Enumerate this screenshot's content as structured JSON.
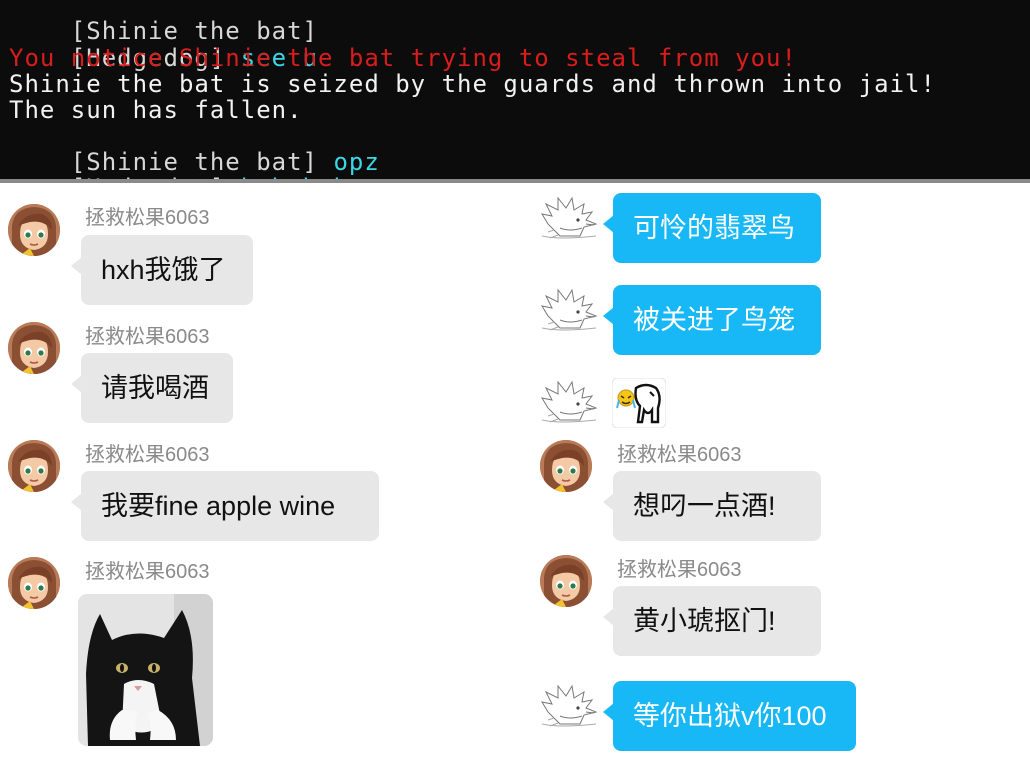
{
  "terminal": {
    "lines": [
      {
        "speaker": "[Shinie the bat]",
        "text": ""
      },
      {
        "speaker": "[Hedgedog]",
        "text": "see u"
      },
      {
        "alert": "You notice Shinie the bat trying to steal from you!"
      },
      {
        "plain": "Shinie the bat is seized by the guards and thrown into jail!"
      },
      {
        "plain": "The sun has fallen."
      },
      {
        "speaker": "[Shinie the bat]",
        "text": "opz"
      },
      {
        "speaker": "[Hedgedog]",
        "text": "hahahaha"
      }
    ]
  },
  "chat": {
    "sender_name": "拯救松果6063",
    "left": [
      {
        "text": "hxh我饿了"
      },
      {
        "text": "请我喝酒"
      },
      {
        "text": "我要fine apple wine"
      },
      {
        "image": "cat-photo"
      }
    ],
    "right": [
      {
        "from": "hedgehog",
        "text": "可怜的翡翠鸟"
      },
      {
        "from": "hedgehog",
        "text": "被关进了鸟笼"
      },
      {
        "from": "hedgehog",
        "sticker": "cat-sticker"
      },
      {
        "from": "girl",
        "text": "想叼一点酒!"
      },
      {
        "from": "girl",
        "text": "黄小琥抠门!"
      },
      {
        "from": "hedgehog",
        "text": "等你出狱v你100"
      }
    ]
  },
  "colors": {
    "terminal_bg": "#0c0c0c",
    "terminal_text": "#f2f2f2",
    "terminal_alert": "#d91c1c",
    "terminal_chat": "#3ad7e6",
    "bubble_grey": "#e7e7e7",
    "bubble_blue": "#17b8f5",
    "name_grey": "#8a8a8a"
  }
}
